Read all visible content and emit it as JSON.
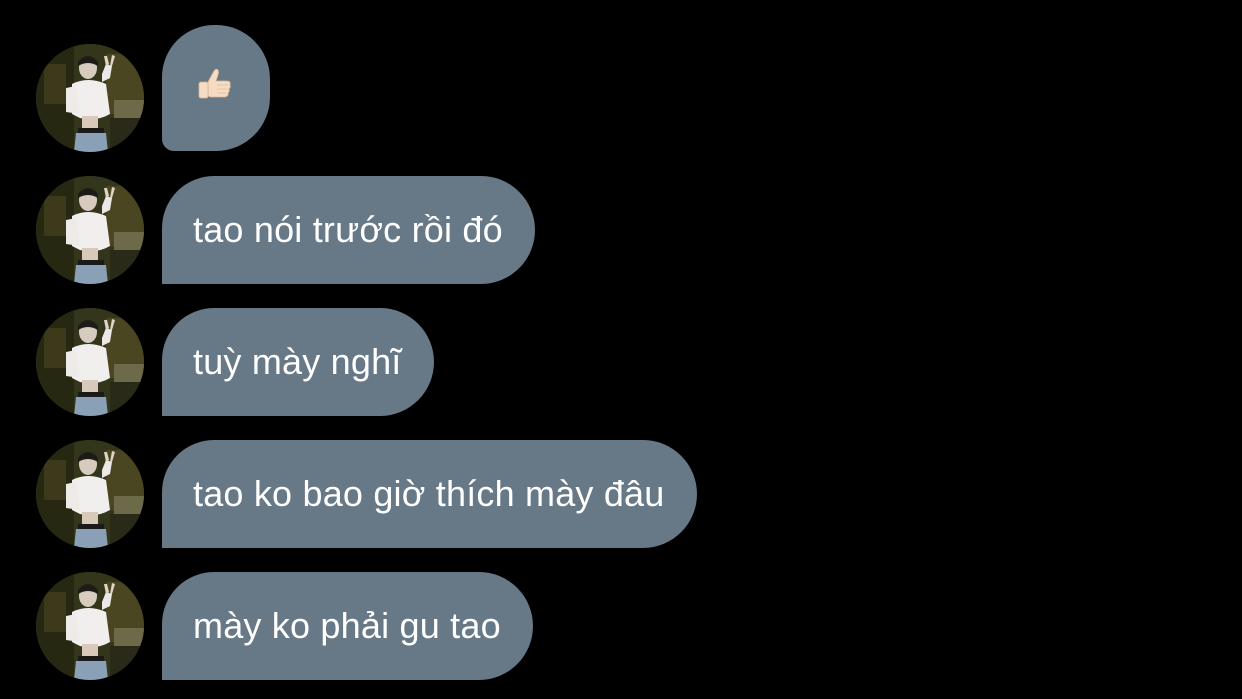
{
  "conversation": {
    "messages": [
      {
        "type": "emoji",
        "icon": "thumbs-up-icon",
        "skin_tone": "light"
      },
      {
        "type": "text",
        "text": "tao nói trước rồi đó"
      },
      {
        "type": "text",
        "text": "tuỳ mày nghĩ"
      },
      {
        "type": "text",
        "text": "tao ko bao giờ thích mày đâu"
      },
      {
        "type": "text",
        "text": "mày ko phải gu tao"
      }
    ],
    "bubble_color": "#677887",
    "background_color": "#000000"
  }
}
